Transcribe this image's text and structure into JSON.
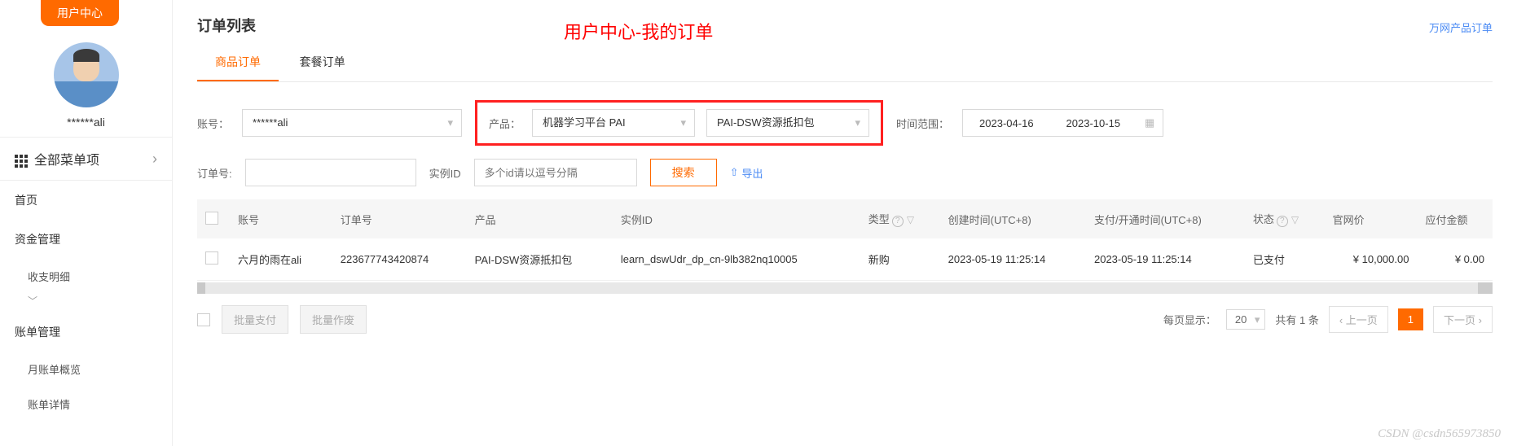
{
  "sidebar": {
    "uc_tab": "用户中心",
    "username": "******ali",
    "all_menu": "全部菜单项",
    "items": [
      "首页",
      "资金管理",
      "账单管理"
    ],
    "subs_fund": [
      "收支明细"
    ],
    "subs_bill": [
      "月账单概览",
      "账单详情"
    ]
  },
  "header": {
    "title": "订单列表",
    "annotation": "用户中心-我的订单",
    "top_link": "万网产品订单"
  },
  "tabs": {
    "t1": "商品订单",
    "t2": "套餐订单"
  },
  "filters": {
    "account_label": "账号：",
    "account_value": "******ali",
    "product_label": "产品：",
    "product_value": "机器学习平台 PAI",
    "subproduct_value": "PAI-DSW资源抵扣包",
    "time_label": "时间范围：",
    "date_start": "2023-04-16",
    "date_end": "2023-10-15",
    "order_no_label": "订单号:",
    "instance_label": "实例ID",
    "instance_placeholder": "多个id请以逗号分隔",
    "search_btn": "搜索",
    "export": "导出"
  },
  "table": {
    "headers": {
      "account": "账号",
      "order_no": "订单号",
      "product": "产品",
      "instance": "实例ID",
      "type": "类型",
      "create_time": "创建时间(UTC+8)",
      "pay_time": "支付/开通时间(UTC+8)",
      "status": "状态",
      "official_price": "官网价",
      "payable": "应付金额"
    },
    "rows": [
      {
        "account": "六月的雨在ali",
        "order_no": "223677743420874",
        "product": "PAI-DSW资源抵扣包",
        "instance": "learn_dswUdr_dp_cn-9lb382nq10005",
        "type": "新购",
        "create_time": "2023-05-19 11:25:14",
        "pay_time": "2023-05-19 11:25:14",
        "status": "已支付",
        "official_price": "¥ 10,000.00",
        "payable": "¥ 0.00"
      }
    ]
  },
  "footer": {
    "batch_pay": "批量支付",
    "batch_void": "批量作废",
    "per_page_label": "每页显示：",
    "page_size": "20",
    "total_text": "共有 1 条",
    "prev": "上一页",
    "page_num": "1",
    "next": "下一页"
  },
  "watermark": "CSDN @csdn565973850"
}
